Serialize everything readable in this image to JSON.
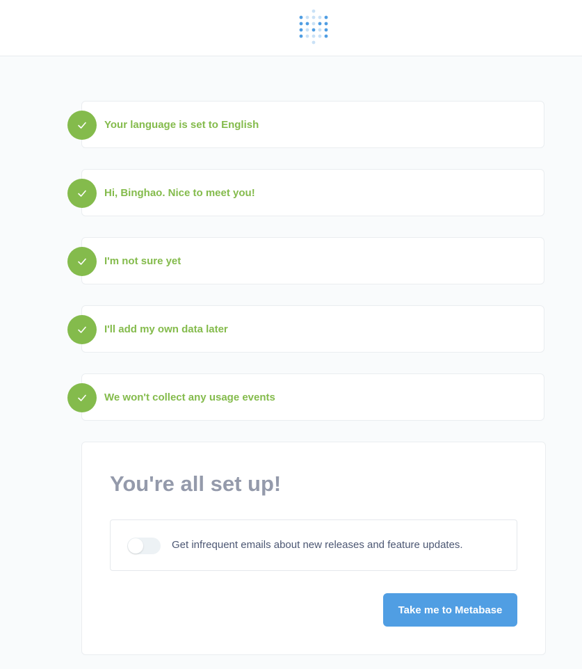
{
  "header": {
    "logo_icon": "metabase-logo-icon"
  },
  "steps": [
    {
      "label": "Your language is set to English"
    },
    {
      "label": "Hi, Binghao. Nice to meet you!"
    },
    {
      "label": "I'm not sure yet"
    },
    {
      "label": "I'll add my own data later"
    },
    {
      "label": "We won't collect any usage events"
    }
  ],
  "final": {
    "title": "You're all set up!",
    "newsletter_text": "Get infrequent emails about new releases and feature updates.",
    "newsletter_toggle_on": false,
    "cta_label": "Take me to Metabase"
  },
  "colors": {
    "success": "#84bb4c",
    "brand": "#509ee3",
    "title": "#949aab",
    "text": "#4c5773",
    "background": "#f9fbfc"
  }
}
